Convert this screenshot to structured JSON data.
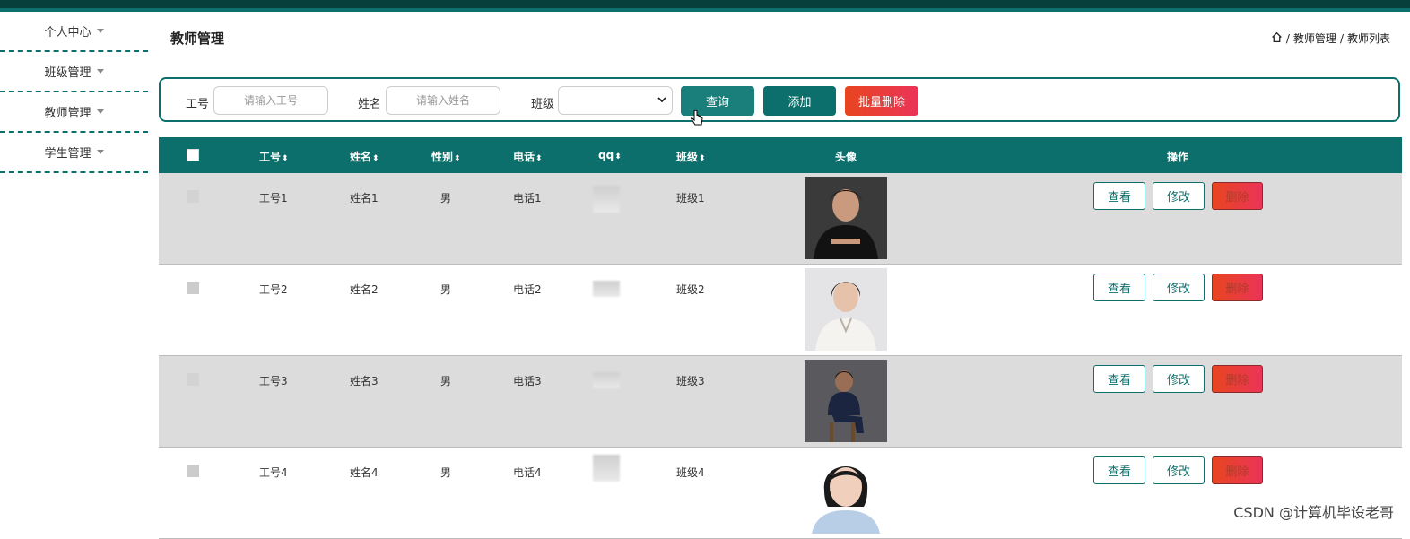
{
  "sidebar": {
    "items": [
      {
        "label": "个人中心"
      },
      {
        "label": "班级管理"
      },
      {
        "label": "教师管理"
      },
      {
        "label": "学生管理"
      }
    ]
  },
  "header": {
    "title": "教师管理",
    "breadcrumb": [
      "教师管理",
      "教师列表"
    ],
    "separator": "/"
  },
  "search": {
    "id_label": "工号",
    "id_placeholder": "请输入工号",
    "name_label": "姓名",
    "name_placeholder": "请输入姓名",
    "class_label": "班级",
    "class_value": "",
    "query_label": "查询",
    "add_label": "添加",
    "batch_delete_label": "批量删除"
  },
  "table": {
    "columns": {
      "id": "工号",
      "name": "姓名",
      "gender": "性别",
      "phone": "电话",
      "qq": "qq",
      "class": "班级",
      "avatar": "头像",
      "actions": "操作"
    },
    "sort_glyph": "⬍",
    "actions": {
      "view": "查看",
      "edit": "修改",
      "delete": "删除"
    },
    "rows": [
      {
        "id": "工号1",
        "name": "姓名1",
        "gender": "男",
        "phone": "电话1",
        "class": "班级1"
      },
      {
        "id": "工号2",
        "name": "姓名2",
        "gender": "男",
        "phone": "电话2",
        "class": "班级2"
      },
      {
        "id": "工号3",
        "name": "姓名3",
        "gender": "男",
        "phone": "电话3",
        "class": "班级3"
      },
      {
        "id": "工号4",
        "name": "姓名4",
        "gender": "男",
        "phone": "电话4",
        "class": "班级4"
      }
    ]
  },
  "watermark": "CSDN @计算机毕设老哥",
  "colors": {
    "primary": "#0c6f6b",
    "danger": "#e8451f",
    "row_alt": "#dcdcdc"
  }
}
